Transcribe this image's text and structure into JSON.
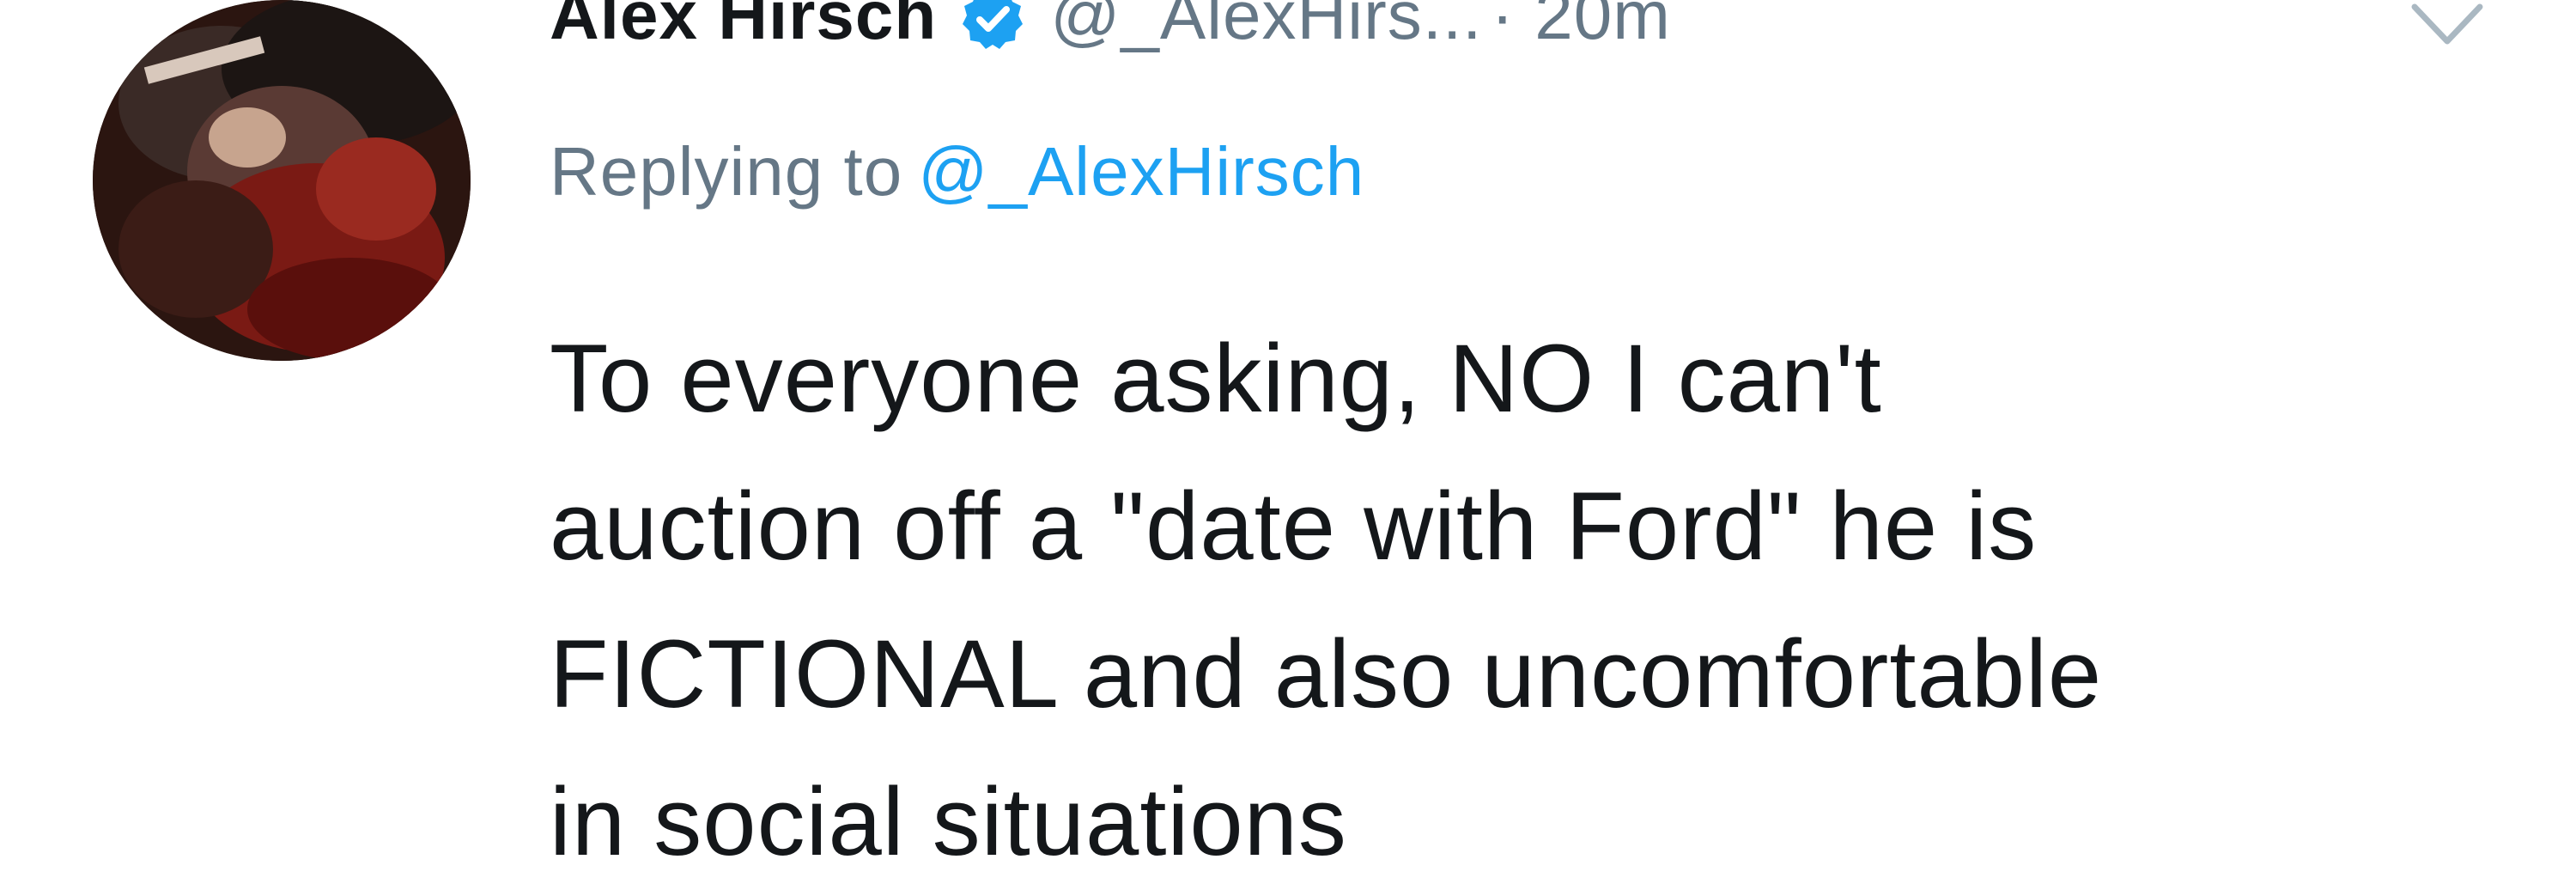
{
  "tweet": {
    "author": {
      "display_name": "Alex Hirsch",
      "handle": "@_AlexHirs...",
      "verified": true,
      "avatar_icon": "profile-photo"
    },
    "time": "· 20m",
    "reply": {
      "prefix": "Replying to",
      "mention": "@_AlexHirsch"
    },
    "text_lines": [
      "To everyone asking, NO I can't",
      "auction off a \"date with Ford\" he is",
      "FICTIONAL and also uncomfortable",
      "in social situations"
    ],
    "menu_icon": "chevron-down-icon"
  },
  "colors": {
    "text_primary": "#14171a",
    "text_secondary": "#657786",
    "link": "#1da1f2",
    "verified_badge": "#1da1f2",
    "background": "#ffffff"
  }
}
